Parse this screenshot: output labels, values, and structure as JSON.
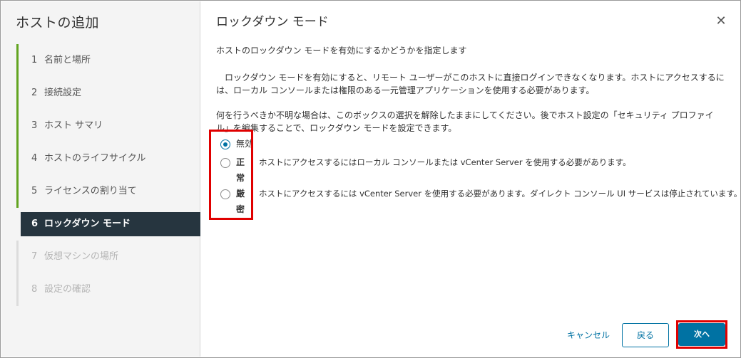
{
  "wizard": {
    "title": "ホストの追加",
    "steps": [
      {
        "num": "1",
        "label": "名前と場所",
        "state": "done"
      },
      {
        "num": "2",
        "label": "接続設定",
        "state": "done"
      },
      {
        "num": "3",
        "label": "ホスト サマリ",
        "state": "done"
      },
      {
        "num": "4",
        "label": "ホストのライフサイクル",
        "state": "done"
      },
      {
        "num": "5",
        "label": "ライセンスの割り当て",
        "state": "done"
      },
      {
        "num": "6",
        "label": "ロックダウン モード",
        "state": "current"
      },
      {
        "num": "7",
        "label": "仮想マシンの場所",
        "state": "future"
      },
      {
        "num": "8",
        "label": "設定の確認",
        "state": "future"
      }
    ]
  },
  "page": {
    "title": "ロックダウン モード",
    "intro": "ホストのロックダウン モードを有効にするかどうかを指定します",
    "para1": "　ロックダウン モードを有効にすると、リモート ユーザーがこのホストに直接ログインできなくなります。ホストにアクセスするには、ローカル コンソールまたは権限のある一元管理アプリケーションを使用する必要があります。",
    "para2": "何を行うべきか不明な場合は、このボックスの選択を解除したままにしてください。後でホスト設定の「セキュリティ プロファイル」を編集することで、ロックダウン モードを設定できます。",
    "options": [
      {
        "label": "無効",
        "description": "",
        "checked": true
      },
      {
        "label": "正常",
        "description": "ホストにアクセスするにはローカル コンソールまたは vCenter Server を使用する必要があります。",
        "checked": false
      },
      {
        "label": "厳密",
        "description": "ホストにアクセスするには vCenter Server を使用する必要があります。ダイレクト コンソール UI サービスは停止されています。",
        "checked": false
      }
    ]
  },
  "footer": {
    "cancel": "キャンセル",
    "back": "戻る",
    "next": "次へ"
  },
  "icons": {
    "close": "close-icon"
  },
  "colors": {
    "accent": "#0072a3",
    "nav_active_bg": "#26353f",
    "progress": "#62a420",
    "highlight": "#e00000"
  }
}
